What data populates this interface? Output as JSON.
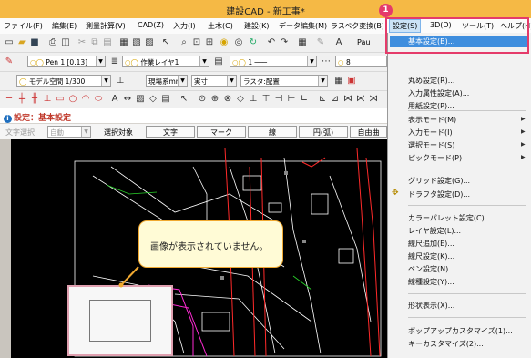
{
  "window": {
    "title": "建設CAD - 新工事*"
  },
  "menubar": {
    "items": [
      "ファイル(F)",
      "編集(E)",
      "測量計算(V)",
      "CAD(Z)",
      "入力(I)",
      "土木(C)",
      "建設(K)",
      "データ編集(M)",
      "ラスベク変換(B)",
      "設定(S)",
      "3D(D)",
      "ツール(T)",
      "ヘルプ(H)"
    ],
    "active_index": 9
  },
  "toolbar": {
    "pen_combo": "Pen 1 [0.13]",
    "layer_combo": "作業レイヤ1",
    "linetype_combo": "1",
    "number_combo": "8",
    "paper_text": "Pau",
    "space_combo": "モデル空間 1/300",
    "unit_combo": "現場系mm",
    "scale_combo": "実寸",
    "raster_combo": "ラスタ:配置"
  },
  "settings_bar": {
    "label": "設定：基本設定"
  },
  "option_bar": {
    "text_select_label": "文字選択",
    "auto_combo": "自動",
    "target_label": "選択対象",
    "buttons": [
      "文字",
      "マーク",
      "線",
      "円(弧)",
      "自由曲"
    ]
  },
  "dropdown": {
    "items": [
      {
        "label": "基本設定(B)...",
        "selected": true
      },
      {
        "label": "丸め設定(R)..."
      },
      {
        "label": "入力属性設定(A)..."
      },
      {
        "label": "用紙設定(P)..."
      },
      {
        "label": "表示モード(M)",
        "submenu": true
      },
      {
        "label": "入力モード(I)",
        "submenu": true
      },
      {
        "label": "選択モード(S)",
        "submenu": true
      },
      {
        "label": "ピックモード(P)",
        "submenu": true
      },
      {
        "label": "グリッド設定(G)..."
      },
      {
        "label": "ドラフタ設定(D)..."
      },
      {
        "label": "カラーパレット設定(C)..."
      },
      {
        "label": "レイヤ設定(L)..."
      },
      {
        "label": "線尺追加(E)..."
      },
      {
        "label": "線尺設定(K)..."
      },
      {
        "label": "ペン設定(N)..."
      },
      {
        "label": "線種設定(Y)..."
      },
      {
        "label": "形状表示(X)..."
      },
      {
        "label": "ポップアップカスタマイズ(1)..."
      },
      {
        "label": "キーカスタマイズ(2)..."
      }
    ]
  },
  "annotation": {
    "badge": "1",
    "callout": "画像が表示されていません。"
  },
  "colors": {
    "title_bar": "#f5b945",
    "menu_highlight": "#3f8ede",
    "annotation": "#e53b6a",
    "cad_background": "#000000"
  }
}
